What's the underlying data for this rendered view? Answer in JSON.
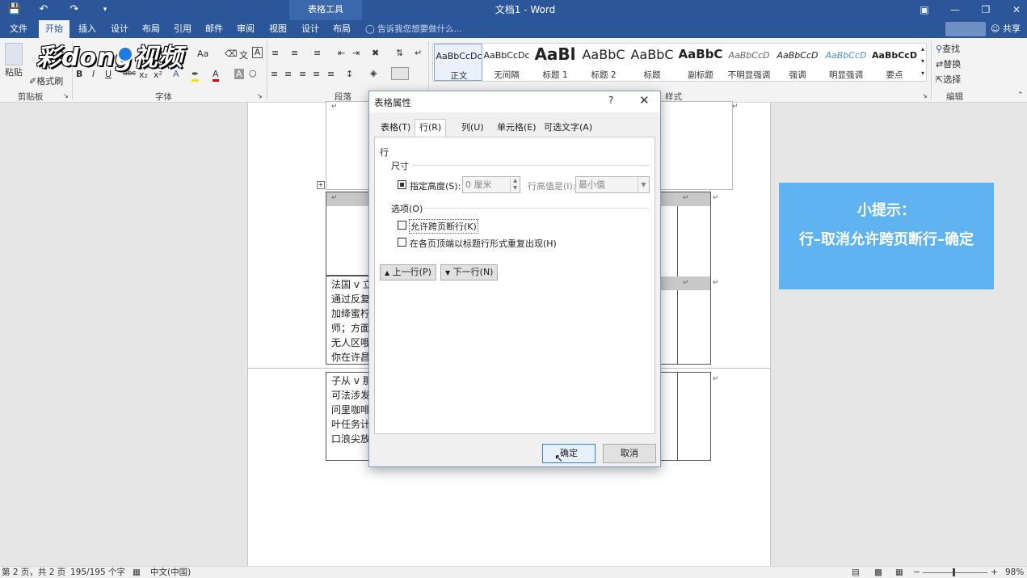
{
  "titlebar": {
    "context_tab": "表格工具",
    "doc_title": "文档1 - Word"
  },
  "menu": {
    "items": [
      "文件",
      "开始",
      "插入",
      "设计",
      "布局",
      "引用",
      "邮件",
      "审阅",
      "视图",
      "设计",
      "布局"
    ],
    "active_index": 1,
    "tell_me": "告诉我您想要做什么...",
    "share": "共享"
  },
  "ribbon": {
    "paste": "粘贴",
    "format_painter": "格式刷",
    "group_labels": {
      "clipboard": "剪贴板",
      "font": "字体",
      "paragraph": "段落",
      "styles": "样式",
      "editing": "编辑"
    },
    "font_size_btn": "Aa",
    "bold": "B",
    "italic": "I",
    "underline": "U",
    "strike": "abc",
    "styles": [
      {
        "sample": "AaBbCcDc",
        "name": "正文"
      },
      {
        "sample": "AaBbCcDc",
        "name": "无间隔"
      },
      {
        "sample": "AaBl",
        "name": "标题 1"
      },
      {
        "sample": "AaBbC",
        "name": "标题 2"
      },
      {
        "sample": "AaBbC",
        "name": "标题"
      },
      {
        "sample": "AaBbC",
        "name": "副标题"
      },
      {
        "sample": "AaBbCcD",
        "name": "不明显强调"
      },
      {
        "sample": "AaBbCcD",
        "name": "强调"
      },
      {
        "sample": "AaBbCcD",
        "name": "明显强调"
      },
      {
        "sample": "AaBbCcD",
        "name": "要点"
      }
    ],
    "find": "查找",
    "replace": "替换",
    "select": "选择"
  },
  "overlay_logo": "彩dong视频",
  "document": {
    "cell_lines_1": [
      "法国 v 立",
      "通过反复",
      "加绛蜜柠",
      "师；方面",
      "无人区哦",
      "你在许昌"
    ],
    "cell_lines_2": [
      "子从 v 那",
      "可法涉发",
      "问里咖啡",
      "叶任务计",
      "口浪尖放"
    ]
  },
  "tip": {
    "title": "小提示：",
    "body": "行–取消允许跨页断行–确定"
  },
  "dialog": {
    "title": "表格属性",
    "help": "?",
    "close": "✕",
    "tabs": [
      "表格(T)",
      "行(R)",
      "列(U)",
      "单元格(E)",
      "可选文字(A)"
    ],
    "active_tab": 1,
    "section_row": "行",
    "section_size": "尺寸",
    "specify_height": "指定高度(S):",
    "height_value": "0 厘米",
    "row_height_is": "行高值是(I):",
    "row_height_mode": "最小值",
    "section_options": "选项(O)",
    "allow_break": "允许跨页断行(K)",
    "repeat_header": "在各页顶端以标题行形式重复出现(H)",
    "prev_row": "上一行(P)",
    "next_row": "下一行(N)",
    "ok": "确定",
    "cancel": "取消",
    "specify_height_checked": true,
    "allow_break_checked": false,
    "repeat_header_checked": false
  },
  "status": {
    "page": "第 2 页，共 2 页",
    "words": "195/195 个字",
    "language": "中文(中国)",
    "zoom": "98%"
  }
}
